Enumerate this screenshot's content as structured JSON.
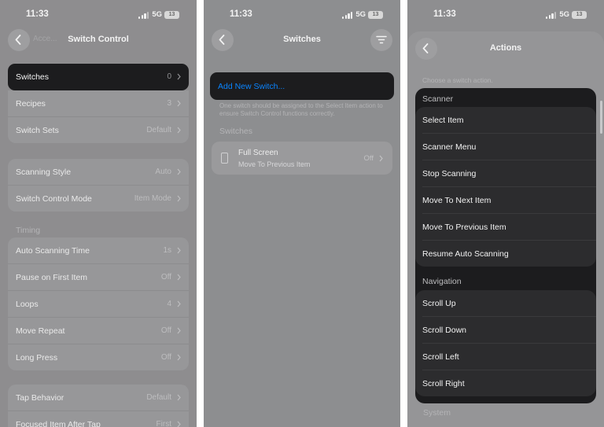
{
  "status": {
    "time": "11:33",
    "network": "5G",
    "battery": "13"
  },
  "screen1": {
    "title": "Switch Control",
    "ghost_text": "Acce...",
    "group1": [
      {
        "label": "Switches",
        "value": "0"
      },
      {
        "label": "Recipes",
        "value": "3"
      },
      {
        "label": "Switch Sets",
        "value": "Default"
      }
    ],
    "group2": [
      {
        "label": "Scanning Style",
        "value": "Auto"
      },
      {
        "label": "Switch Control Mode",
        "value": "Item Mode"
      }
    ],
    "timing_header": "Timing",
    "group3": [
      {
        "label": "Auto Scanning Time",
        "value": "1s"
      },
      {
        "label": "Pause on First Item",
        "value": "Off"
      },
      {
        "label": "Loops",
        "value": "4"
      },
      {
        "label": "Move Repeat",
        "value": "Off"
      },
      {
        "label": "Long Press",
        "value": "Off"
      }
    ],
    "group4": [
      {
        "label": "Tap Behavior",
        "value": "Default"
      },
      {
        "label": "Focused Item After Tap",
        "value": "First"
      }
    ]
  },
  "screen2": {
    "title": "Switches",
    "add_button": "Add New Switch...",
    "note": "One switch should be assigned to the Select Item action to ensure Switch Control functions correctly.",
    "switches_header": "Switches",
    "switch_item": {
      "name": "Full Screen",
      "action": "Move To Previous Item",
      "value": "Off"
    }
  },
  "screen3": {
    "title": "Actions",
    "subtitle": "Choose a switch action.",
    "scanner_header": "Scanner",
    "scanner_items": [
      "Select Item",
      "Scanner Menu",
      "Stop Scanning",
      "Move To Next Item",
      "Move To Previous Item",
      "Resume Auto Scanning"
    ],
    "navigation_header": "Navigation",
    "navigation_items": [
      "Scroll Up",
      "Scroll Down",
      "Scroll Left",
      "Scroll Right"
    ],
    "system_header": "System"
  },
  "colors": {
    "accent_blue": "#0a84ff",
    "highlight_dark": "#1c1c1e",
    "dim_overlay": "#8e8d8f"
  },
  "icons": [
    "back-chevron-icon",
    "filter-icon",
    "chevron-right-icon",
    "phone-screen-icon",
    "signal-icon",
    "battery-icon"
  ]
}
